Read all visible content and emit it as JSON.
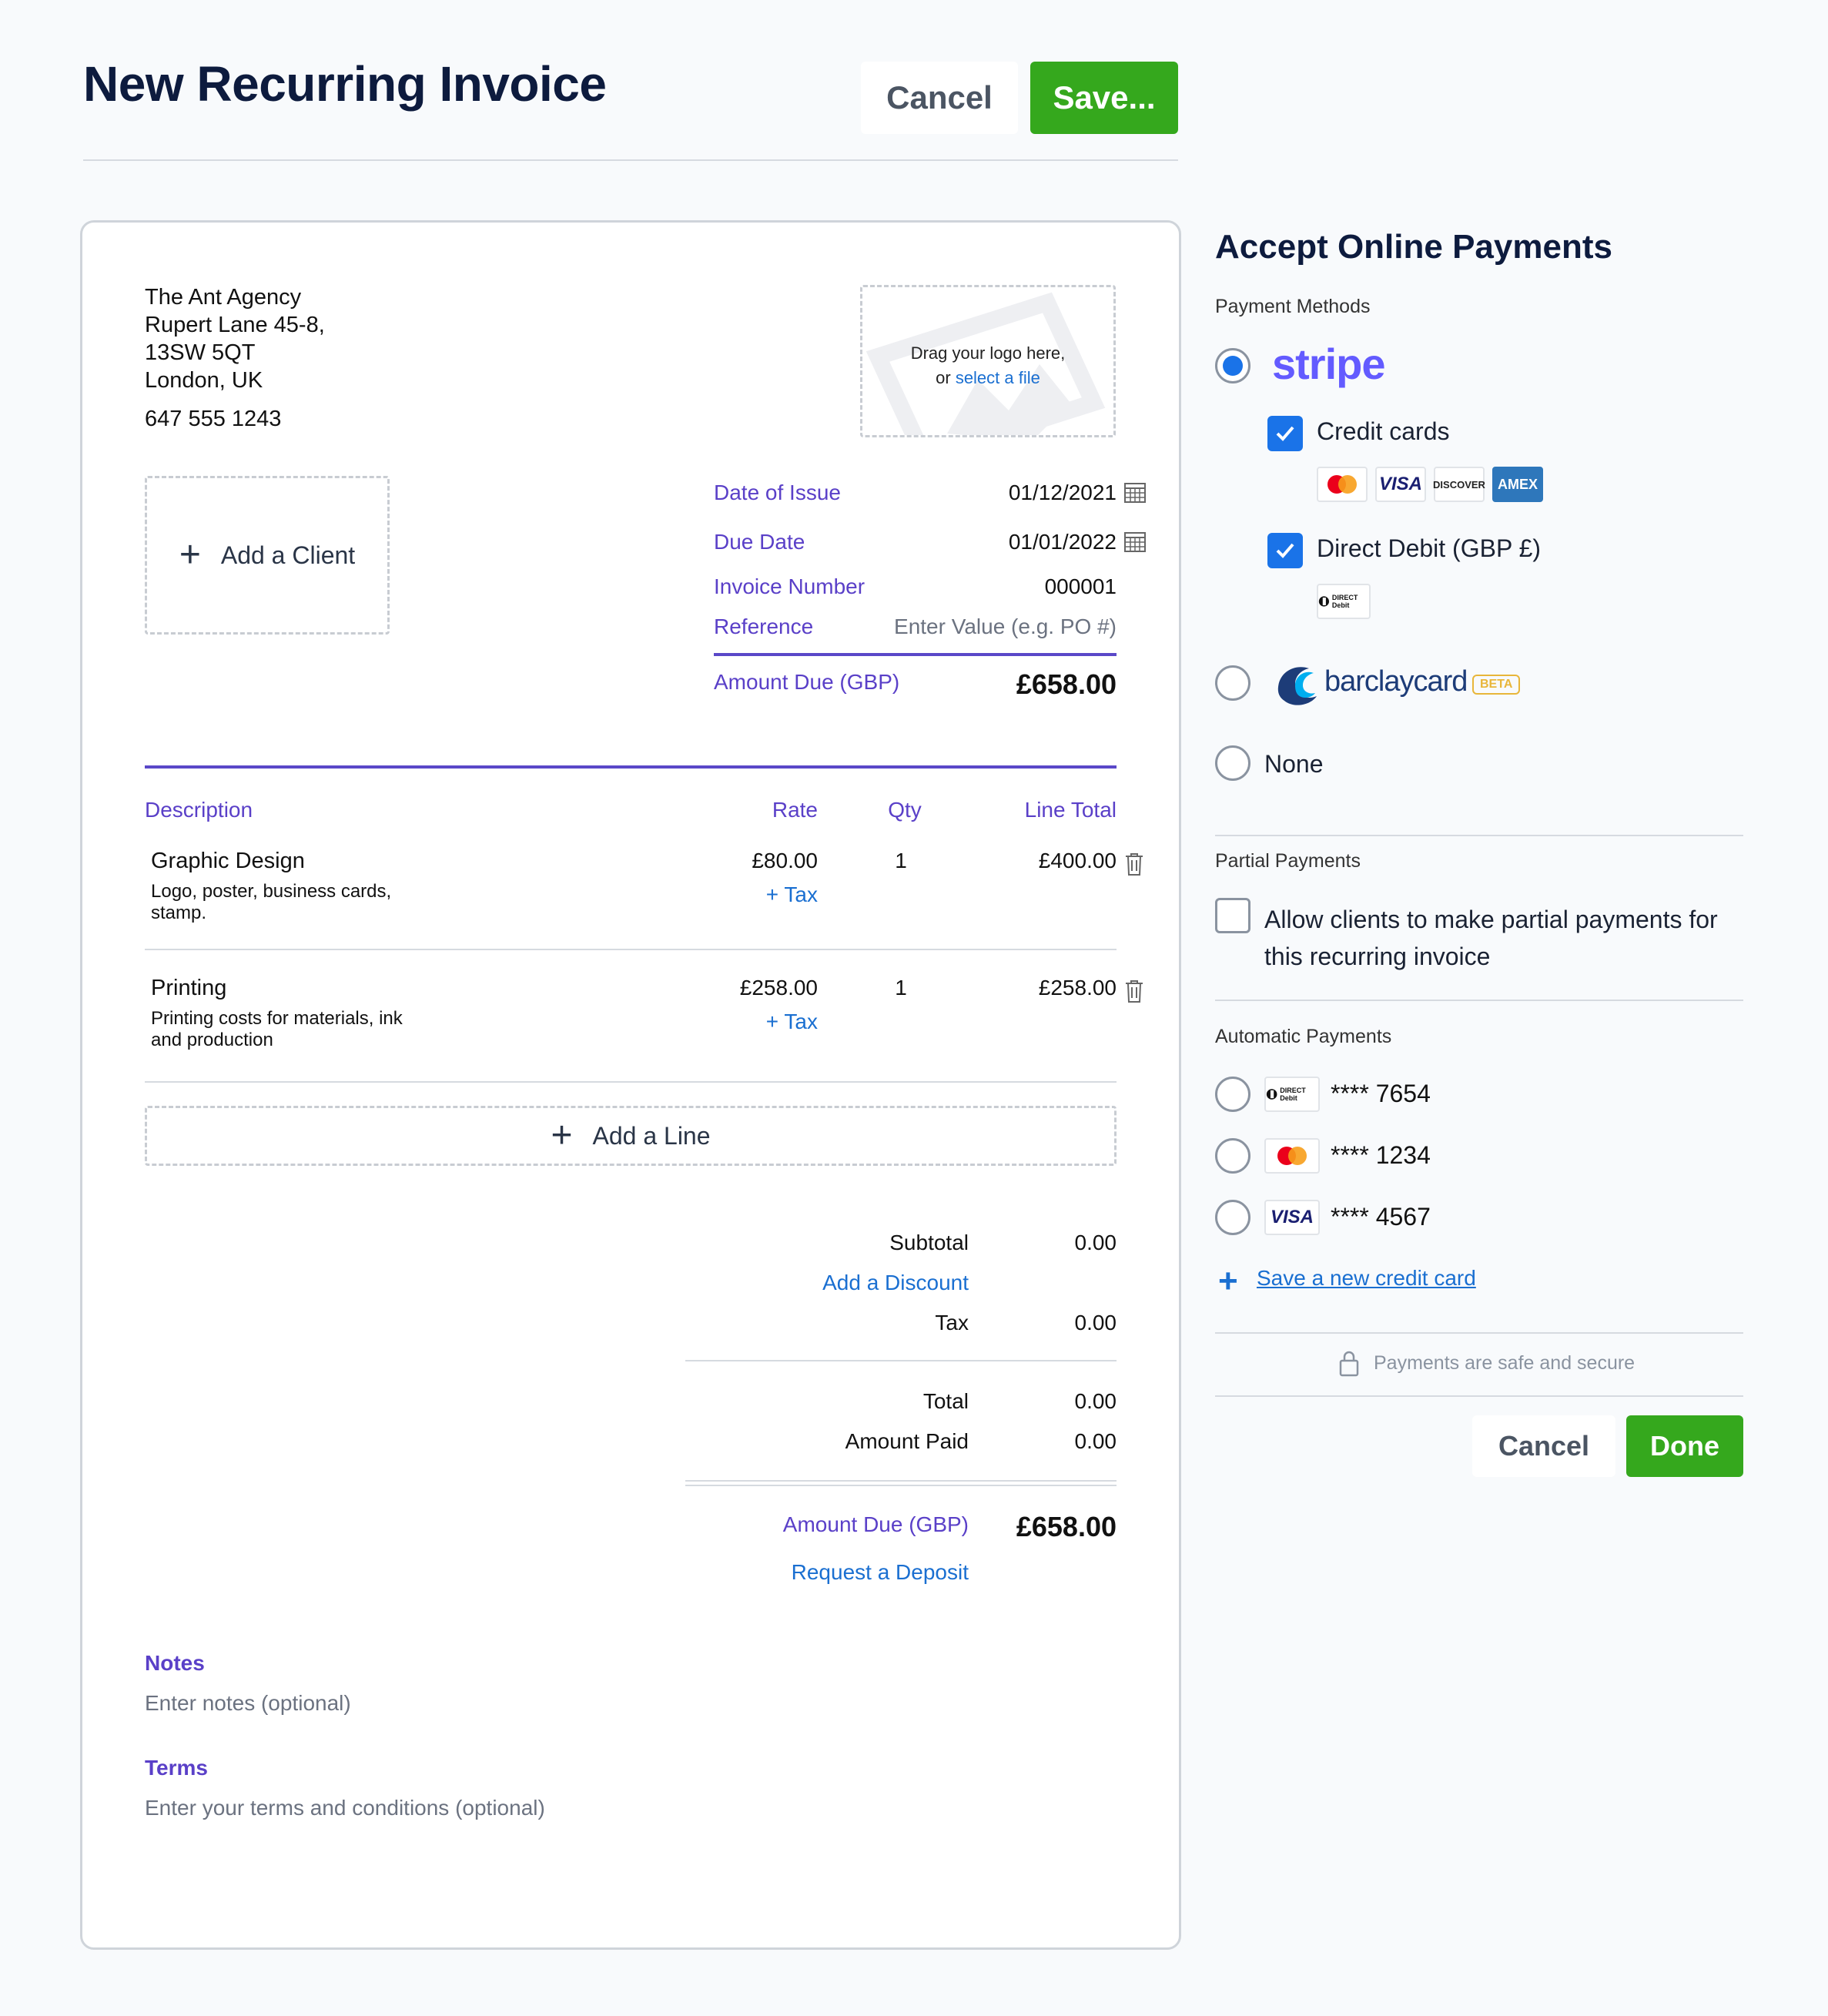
{
  "header": {
    "title": "New Recurring Invoice",
    "cancel_label": "Cancel",
    "save_label": "Save..."
  },
  "business": {
    "name": "The Ant Agency",
    "address_line1": "Rupert Lane 45-8,",
    "address_line2": "13SW 5QT",
    "address_line3": "London, UK",
    "phone": "647 555 1243"
  },
  "logo_upload": {
    "text": "Drag your logo here,",
    "or": "or",
    "link": "select a file"
  },
  "client": {
    "add_label": "Add a Client"
  },
  "meta": {
    "date_of_issue_label": "Date of Issue",
    "date_of_issue": "01/12/2021",
    "due_date_label": "Due Date",
    "due_date": "01/01/2022",
    "invoice_number_label": "Invoice Number",
    "invoice_number": "000001",
    "reference_label": "Reference",
    "reference_placeholder": "Enter Value (e.g. PO #)",
    "amount_due_label": "Amount Due (GBP)",
    "amount_due": "£658.00"
  },
  "table": {
    "headers": {
      "description": "Description",
      "rate": "Rate",
      "qty": "Qty",
      "line_total": "Line Total"
    },
    "rows": [
      {
        "title": "Graphic Design",
        "desc1": "Logo, poster, business cards,",
        "desc2": "stamp.",
        "rate": "£80.00",
        "tax": "+ Tax",
        "qty": "1",
        "total": "£400.00"
      },
      {
        "title": "Printing",
        "desc1": "Printing costs for materials, ink",
        "desc2": "and production",
        "rate": "£258.00",
        "tax": "+ Tax",
        "qty": "1",
        "total": "£258.00"
      }
    ],
    "add_line_label": "Add a Line"
  },
  "totals": {
    "subtotal_label": "Subtotal",
    "subtotal": "0.00",
    "add_discount": "Add a Discount",
    "tax_label": "Tax",
    "tax": "0.00",
    "total_label": "Total",
    "total": "0.00",
    "amount_paid_label": "Amount Paid",
    "amount_paid": "0.00",
    "amount_due_label": "Amount Due (GBP)",
    "amount_due": "£658.00",
    "request_deposit": "Request a Deposit"
  },
  "notes": {
    "label": "Notes",
    "placeholder": "Enter notes (optional)"
  },
  "terms": {
    "label": "Terms",
    "placeholder": "Enter your terms and conditions (optional)"
  },
  "payments": {
    "title": "Accept Online Payments",
    "methods_label": "Payment Methods",
    "stripe_logo": "stripe",
    "credit_cards": "Credit cards",
    "card_brands": [
      "VISA",
      "DISCOVER",
      "AMEX"
    ],
    "direct_debit": "Direct Debit (GBP £)",
    "direct_debit_badge": "DIRECT Debit",
    "barclaycard_logo": "barclaycard",
    "beta_badge": "BETA",
    "none_label": "None",
    "partial_label": "Partial Payments",
    "partial_text_1": "Allow clients to make partial payments for",
    "partial_text_2": "this recurring invoice",
    "automatic_label": "Automatic Payments",
    "auto_items": [
      {
        "badge": "DIRECT Debit",
        "number": "**** 7654"
      },
      {
        "badge": "mastercard",
        "number": "**** 1234"
      },
      {
        "badge": "VISA",
        "number": "**** 4567"
      }
    ],
    "save_card": "Save a new credit card",
    "secure_text": "Payments are safe and secure",
    "cancel_label": "Cancel",
    "done_label": "Done"
  },
  "colors": {
    "accent_purple": "#5a40c8",
    "link_blue": "#1a6fd1",
    "primary_green": "#35a81d",
    "checkbox_blue": "#1a73e8",
    "stripe": "#635bff"
  }
}
